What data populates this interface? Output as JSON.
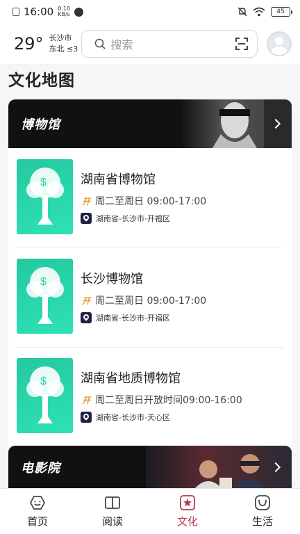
{
  "status_bar": {
    "time": "16:00",
    "net_speed_value": "0.10",
    "net_speed_unit": "KB/s",
    "battery": "45"
  },
  "header": {
    "temperature": "29°",
    "city": "长沙市",
    "wind": "东北 ≤3",
    "search_placeholder": "搜索"
  },
  "page_title": "文化地图",
  "museum_banner": {
    "label": "博物馆"
  },
  "venues": [
    {
      "name": "湖南省博物馆",
      "hours": "周二至周日 09:00-17:00",
      "address": "湖南省-长沙市-开福区",
      "open_badge": "开"
    },
    {
      "name": "长沙博物馆",
      "hours": "周二至周日 09:00-17:00",
      "address": "湖南省-长沙市-开福区",
      "open_badge": "开"
    },
    {
      "name": "湖南省地质博物馆",
      "hours": "周二至周日开放时间09:00-16:00",
      "address": "湖南省-长沙市-天心区",
      "open_badge": "开"
    }
  ],
  "cinema_banner": {
    "label": "电影院"
  },
  "bottom_nav": {
    "items": [
      {
        "label": "首页",
        "icon": "home-icon"
      },
      {
        "label": "阅读",
        "icon": "book-icon"
      },
      {
        "label": "文化",
        "icon": "culture-icon",
        "active": true
      },
      {
        "label": "生活",
        "icon": "life-icon"
      }
    ],
    "active_color": "#b23a48"
  }
}
